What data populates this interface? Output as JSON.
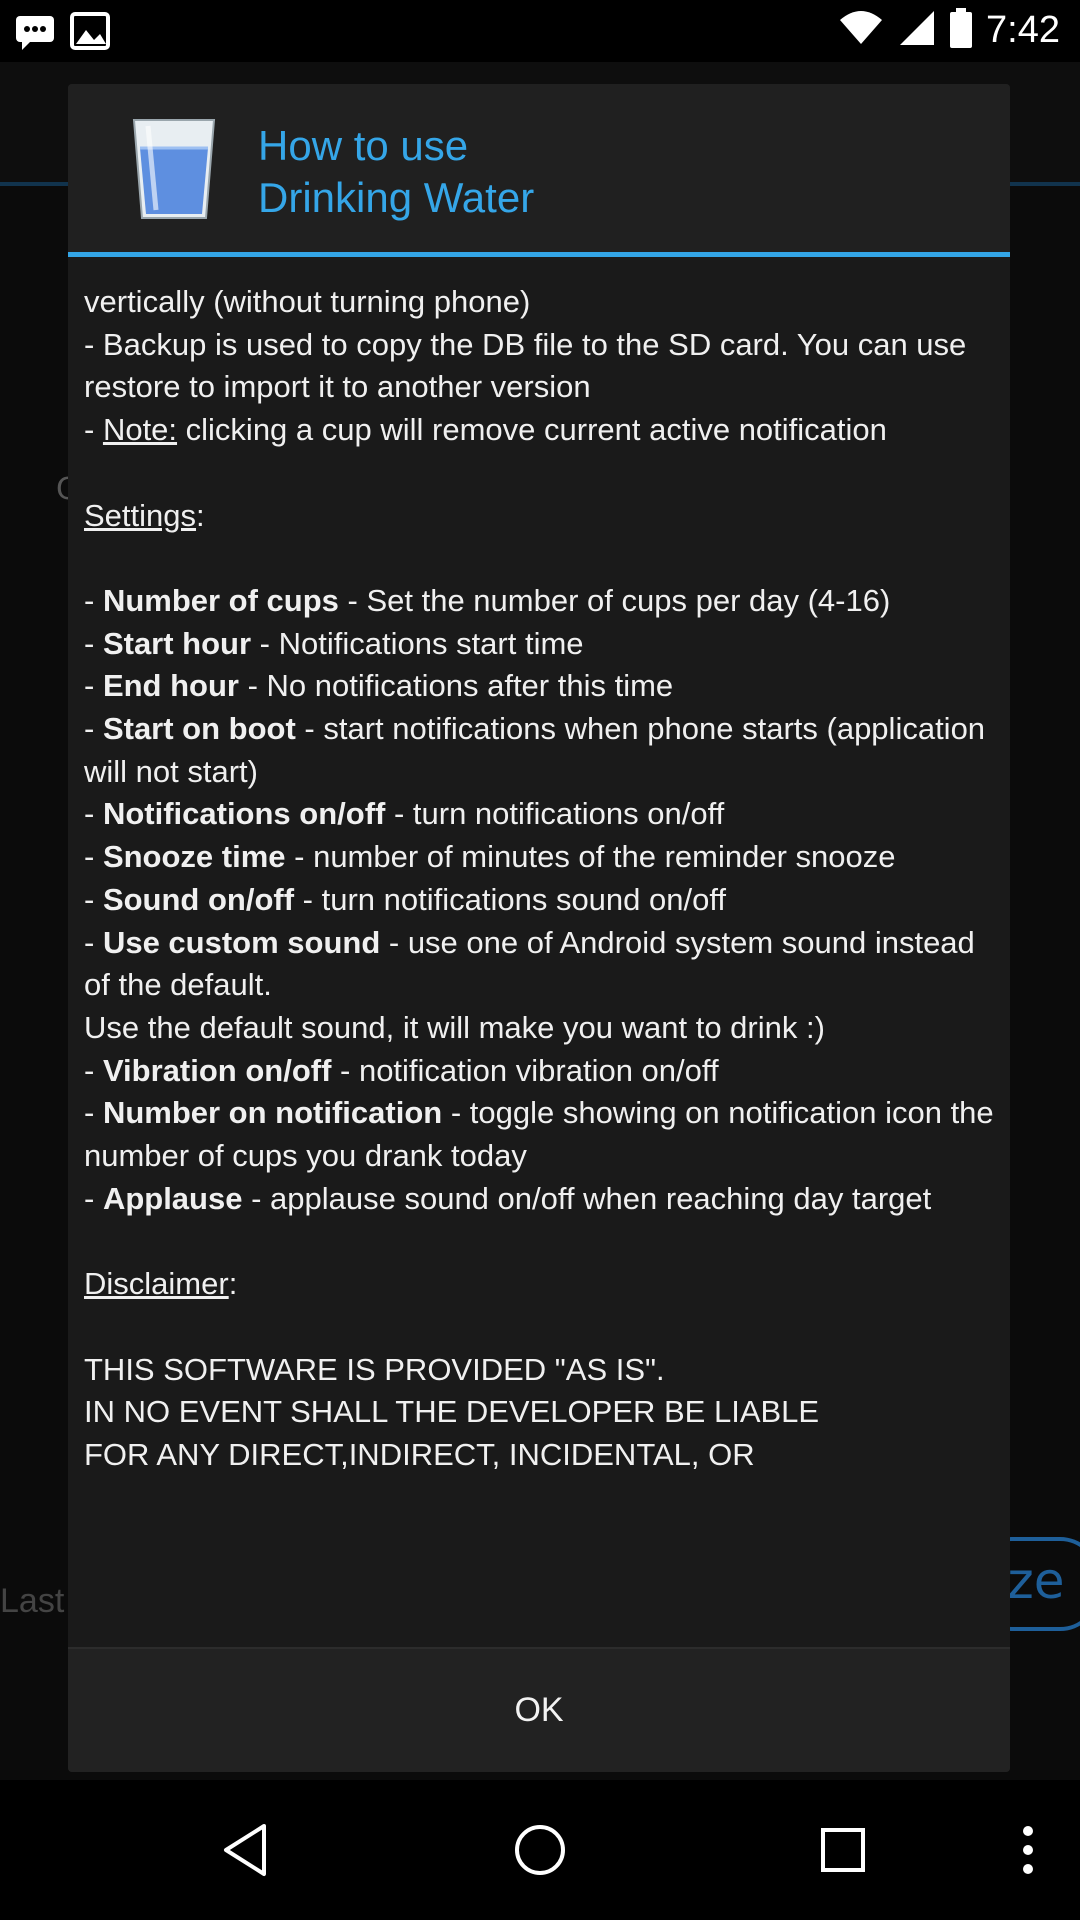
{
  "status_bar": {
    "time": "7:42",
    "icons": [
      "sms-icon",
      "image-icon",
      "wifi-icon",
      "signal-icon",
      "battery-icon"
    ]
  },
  "background_app": {
    "partial_text_last": "Last",
    "partial_text_c": "C",
    "partial_button_label": "ze"
  },
  "dialog": {
    "title_line1": "How to use",
    "title_line2": "Drinking Water",
    "icon": "water-glass-icon",
    "content": {
      "line_partial_top": "vertically (without turning phone)",
      "backup_line": "- Backup is used to copy the DB file to the SD card. You can use restore to import it to another version",
      "note_prefix": "- ",
      "note_label": "Note:",
      "note_text": " clicking a cup will remove current active notification",
      "settings_heading": "Settings",
      "settings_items": [
        {
          "name": "Number of cups",
          "desc": " - Set the number of cups per day (4-16)"
        },
        {
          "name": "Start hour",
          "desc": " - Notifications start time"
        },
        {
          "name": "End hour",
          "desc": " - No notifications after this time"
        },
        {
          "name": "Start on boot",
          "desc": " - start notifications when phone starts (application will not start)"
        },
        {
          "name": "Notifications on/off",
          "desc": " - turn notifications on/off"
        },
        {
          "name": "Snooze time",
          "desc": " - number of minutes of the reminder snooze"
        },
        {
          "name": "Sound on/off",
          "desc": " - turn notifications sound on/off"
        },
        {
          "name": "Use custom sound",
          "desc": " - use one of Android system sound instead of the default.\nUse the default sound, it will make you want to drink :)"
        },
        {
          "name": "Vibration on/off",
          "desc": " - notification vibration on/off"
        },
        {
          "name": "Number on notification",
          "desc": " - toggle showing on notification icon the number of cups you drank today"
        },
        {
          "name": "Applause",
          "desc": " - applause sound on/off when reaching day target"
        }
      ],
      "disclaimer_heading": "Disclaimer",
      "disclaimer_lines": [
        "THIS SOFTWARE IS PROVIDED \"AS IS\".",
        "IN NO EVENT SHALL THE DEVELOPER BE LIABLE",
        "FOR ANY DIRECT,INDIRECT, INCIDENTAL, OR"
      ]
    },
    "ok_label": "OK"
  },
  "nav_bar": {
    "back": "back-icon",
    "home": "home-icon",
    "recents": "recents-icon",
    "menu": "overflow-menu-icon"
  },
  "colors": {
    "accent": "#33a5e6",
    "dialog_bg": "#212121"
  }
}
